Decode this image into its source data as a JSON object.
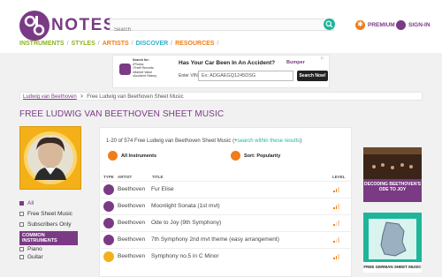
{
  "header": {
    "logo_text": "NOTES",
    "search_placeholder": "Search",
    "premium_label": "PREMIUM",
    "signin_label": "SIGN-IN"
  },
  "nav": [
    {
      "label": "INSTRUMENTS",
      "color": "#8ab51f"
    },
    {
      "label": "STYLES",
      "color": "#8ab51f"
    },
    {
      "label": "ARTISTS",
      "color": "#f07d18"
    },
    {
      "label": "DISCOVER",
      "color": "#2ab0c8"
    },
    {
      "label": "RESOURCES",
      "color": "#f07d18"
    }
  ],
  "ad": {
    "search_for": "Search for:",
    "bullets": [
      "Photos",
      "Theft Records",
      "Market Value",
      "Accident History"
    ],
    "headline": "Has Your Car Been In An Accident?",
    "brand": "Bumper",
    "vin_label": "Enter VIN",
    "vin_value": "Ex: ADGAEGQ1245DSG",
    "button": "Search Now!"
  },
  "breadcrumb": {
    "link": "Ludwig van Beethoven",
    "sep": ">",
    "current": "Free Ludwig van Beethoven Sheet Music"
  },
  "page_title": "FREE LUDWIG VAN BEETHOVEN SHEET MUSIC",
  "filters": {
    "all": "All",
    "free": "Free Sheet Music",
    "subs": "Subscribers Only",
    "common_header": "COMMON INSTRUMENTS",
    "instruments": [
      "Piano",
      "Guitar"
    ]
  },
  "list": {
    "summary_prefix": "1-20 of 574 Free Ludwig van Beethoven Sheet Music (+",
    "summary_link": "search within these results",
    "summary_suffix": ")",
    "all_instruments": "All Instruments",
    "sort": "Sort: Popularity",
    "headers": {
      "type": "TYPE",
      "artist": "ARTIST",
      "title": "TITLE",
      "level": "LEVEL"
    },
    "rows": [
      {
        "artist": "Beethoven",
        "title": "Fur Elise",
        "icon": "piano-icon"
      },
      {
        "artist": "Beethoven",
        "title": "Moonlight Sonata (1st mvt)",
        "icon": "piano-icon"
      },
      {
        "artist": "Beethoven",
        "title": "Ode to Joy (9th Symphony)",
        "icon": "piano-icon"
      },
      {
        "artist": "Beethoven",
        "title": "7th Symphony 2nd mvt theme (easy arrangement)",
        "icon": "piano-icon"
      },
      {
        "artist": "Beethoven",
        "title": "Symphony no.5 in C Minor",
        "icon": "trumpet-icon"
      }
    ]
  },
  "side": {
    "card1": "DECODING BEETHOVEN'S ODE TO JOY",
    "card2": "FREE GERMAN SHEET MUSIC"
  }
}
